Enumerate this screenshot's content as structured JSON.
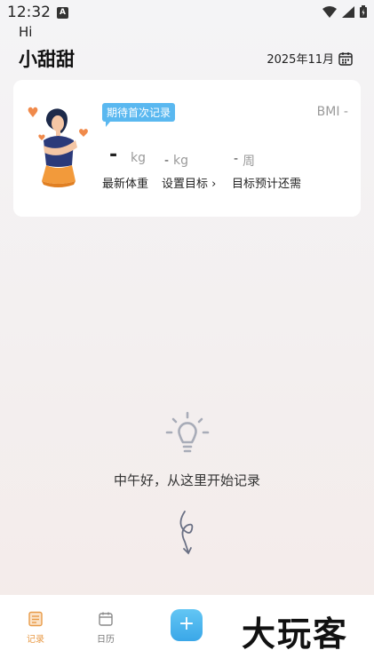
{
  "status_bar": {
    "time": "12:32",
    "app_icon_letter": "A"
  },
  "header": {
    "greeting": "Hi",
    "user_name": "小甜甜",
    "month": "2025年11月"
  },
  "summary": {
    "badge": "期待首次记录",
    "bmi": "BMI -",
    "latest_weight": {
      "value": "-",
      "unit": "kg",
      "label": "最新体重"
    },
    "target": {
      "dash": "-",
      "unit": "kg",
      "label": "设置目标",
      "chevron": "›"
    },
    "weeks_remaining": {
      "dash": "-",
      "unit": "周",
      "label": "目标预计还需"
    }
  },
  "empty_state": {
    "message": "中午好，从这里开始记录"
  },
  "bottom_nav": {
    "items": [
      {
        "label": "记录",
        "icon": "record-icon",
        "active": true
      },
      {
        "label": "日历",
        "icon": "calendar-icon",
        "active": false
      }
    ],
    "add_label": "+"
  },
  "watermark": "大玩客",
  "colors": {
    "accent": "#e89b48",
    "badge_blue": "#5ab8f0",
    "add_button": "#3aa7e8"
  }
}
